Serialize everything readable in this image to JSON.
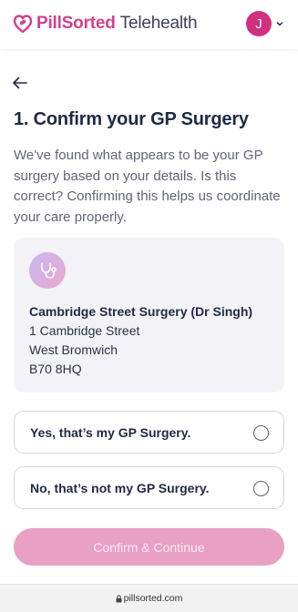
{
  "header": {
    "brand": "PillSorted",
    "brand_suffix": "Telehealth",
    "avatar_initial": "J"
  },
  "page": {
    "title": "1. Confirm your GP Surgery",
    "description": "We've found what appears to be your GP surgery based on your details. Is this correct? Confirming this helps us coordinate your care properly."
  },
  "gp": {
    "name": "Cambridge Street Surgery (Dr Singh)",
    "address_line1": "1 Cambridge Street",
    "address_line2": "West Bromwich",
    "postcode": "B70 8HQ"
  },
  "options": [
    {
      "label": "Yes, that’s my GP Surgery.",
      "selected": false
    },
    {
      "label": "No, that’s not my GP Surgery.",
      "selected": false
    }
  ],
  "actions": {
    "confirm_label": "Confirm & Continue"
  },
  "browser": {
    "url": "pillsorted.com"
  },
  "colors": {
    "brand": "#d2418d",
    "button_disabled": "#e8a0c4",
    "card_bg": "#f3f2f7"
  }
}
